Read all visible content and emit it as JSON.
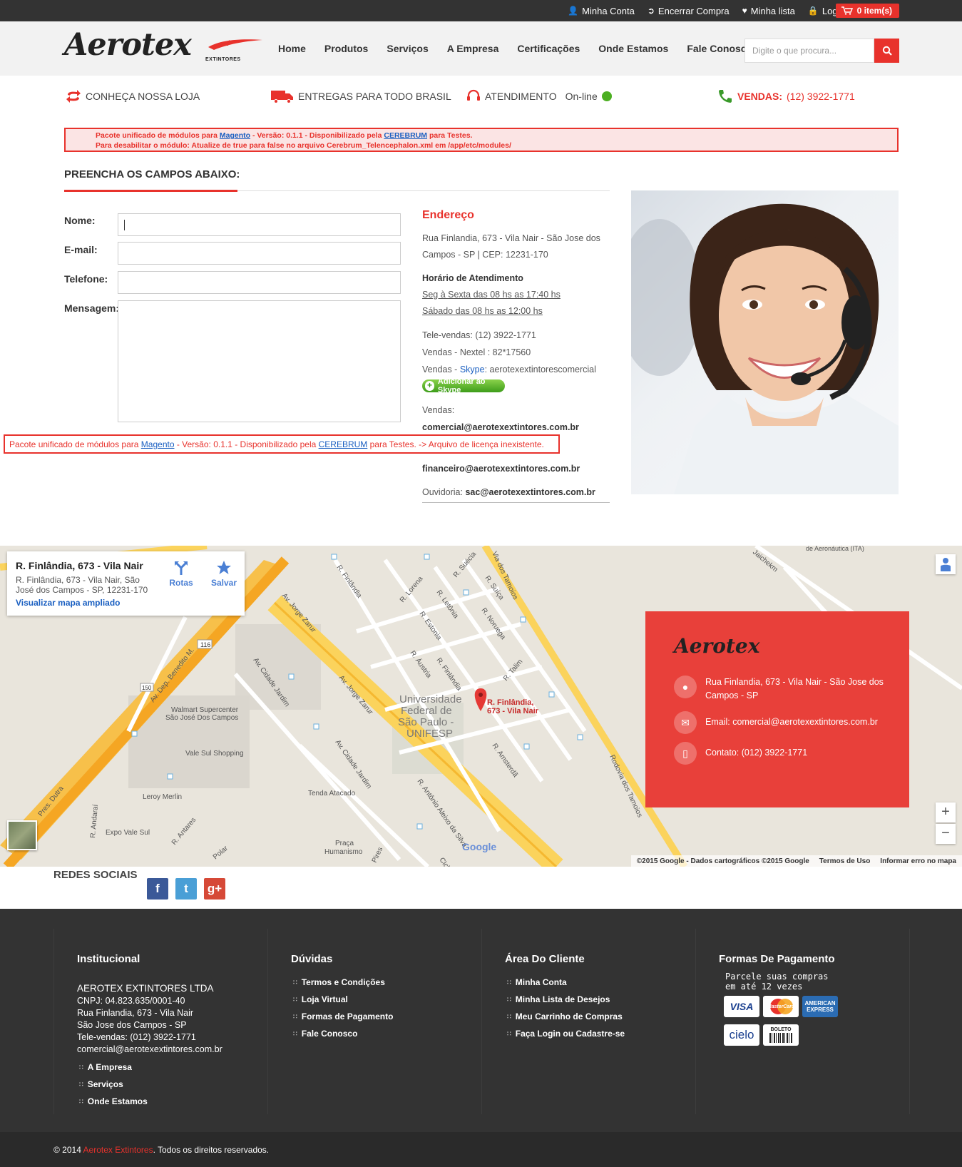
{
  "topbar": {
    "links": [
      {
        "label": "Minha Conta",
        "icon": "user-icon"
      },
      {
        "label": "Encerrar Compra",
        "icon": "checkout-icon"
      },
      {
        "label": "Minha lista",
        "icon": "heart-icon"
      },
      {
        "label": "Log In",
        "icon": "lock-icon"
      }
    ],
    "cart_label": "0 item(s)"
  },
  "header": {
    "logo_text": "Aerotex",
    "logo_sub": "EXTINTORES",
    "nav": [
      "Home",
      "Produtos",
      "Serviços",
      "A Empresa",
      "Certificações",
      "Onde Estamos",
      "Fale Conosco"
    ],
    "search_placeholder": "Digite o que procura..."
  },
  "info_strip": {
    "store": "CONHEÇA NOSSA LOJA",
    "delivery": "ENTREGAS PARA TODO BRASIL",
    "support": "ATENDIMENTO",
    "online": "On-line",
    "sales_label": "VENDAS:",
    "sales_phone": "(12) 3922-1771"
  },
  "notice": {
    "l1_a": "Pacote unificado de módulos para ",
    "l1_link1": "Magento",
    "l1_b": " - Versão: 0.1.1 - Disponibilizado pela ",
    "l1_link2": "CEREBRUM",
    "l1_c": " para Testes.",
    "l2": "Para desabilitar o módulo: Atualize de true para false no arquivo Cerebrum_Telencephalon.xml em /app/etc/modules/"
  },
  "notice2": {
    "a": "Pacote unificado de módulos para ",
    "link1": "Magento",
    "b": " - Versão: 0.1.1 - Disponibilizado pela ",
    "link2": "CEREBRUM",
    "c": " para Testes. -> Arquivo de licença inexistente."
  },
  "form": {
    "title": "PREENCHA OS CAMPOS ABAIXO:",
    "labels": {
      "name": "Nome:",
      "email": "E-mail:",
      "phone": "Telefone:",
      "message": "Mensagem:"
    }
  },
  "address": {
    "title": "Endereço",
    "line1": "Rua Finlandia, 673 - Vila Nair - São Jose dos",
    "line2": "Campos - SP | CEP: 12231-170",
    "hours_title": "Horário de Atendimento",
    "hours1": "Seg à Sexta das 08 hs as 17:40 hs",
    "hours2": "Sábado das 08 hs as 12:00 hs",
    "televendas": "Tele-vendas: (12) 3922-1771",
    "nextel": "Vendas - Nextel : 82*17560",
    "skype_pre": "Vendas - ",
    "skype_word": "Skype",
    "skype_post": ": aerotexextintorescomercial",
    "skype_button": "Adicionar ao Skype",
    "vendas_label": "Vendas:",
    "vendas_email": "comercial@aerotexextintores.com.br",
    "financeiro_email": "financeiro@aerotexextintores.com.br",
    "ouvidoria_label": "Ouvidoria:",
    "ouvidoria_email": "sac@aerotexextintores.com.br"
  },
  "map": {
    "card_title": "R. Finlândia, 673 - Vila Nair",
    "card_address": "R. Finlândia, 673 - Vila Nair, São José dos Campos - SP, 12231-170",
    "card_link": "Visualizar mapa ampliado",
    "routes": "Rotas",
    "save": "Salvar",
    "pin_label_1": "R. Finlândia,",
    "pin_label_2": "673 - Vila Nair",
    "labels": {
      "unifesp": "Universidade Federal de São Paulo - UNIFESP",
      "walmart": "Walmart Supercenter São José Dos Campos",
      "valesul": "Vale Sul Shopping",
      "leroy": "Leroy Merlin",
      "tenda": "Tenda Atacado",
      "expo": "Expo Vale Sul",
      "praca": "Praça Humanismo",
      "aeronautica": "de Aeronáutica (ITA)"
    },
    "roads": [
      "R. Finlândia",
      "R. Suécia",
      "Via dos Tamoios",
      "R. Lorena",
      "R. Letônia",
      "R. Suíça",
      "R. Estonia",
      "R. Noruega",
      "R. Áustria",
      "R. Talim",
      "Av. Jorge Zarur",
      "Av. Dep. Benedito M.",
      "Av. Cidade Jardim",
      "R. Amsterdã",
      "R. Antônio Aleixo da Silva",
      "Rodovia dos Tamoios",
      "Pres. Dutra",
      "R. Andaraí",
      "R. Antares",
      "Polar",
      "Ciclo",
      "Pires",
      "116",
      "150"
    ],
    "footer": [
      "©2015 Google - Dados cartográficos ©2015 Google",
      "Termos de Uso",
      "Informar erro no mapa"
    ],
    "google": "Google",
    "box": {
      "logo": "Aerotex",
      "address": "Rua Finlandia, 673 - Vila Nair - São Jose dos Campos - SP",
      "email": "Email: comercial@aerotexextintores.com.br",
      "contact": "Contato: (012) 3922-1771"
    }
  },
  "social": {
    "title": "REDES SOCIAIS",
    "items": [
      {
        "name": "facebook",
        "glyph": "f",
        "color": "#3b5998"
      },
      {
        "name": "twitter",
        "glyph": "t",
        "color": "#4a9fd6"
      },
      {
        "name": "googleplus",
        "glyph": "g+",
        "color": "#d64937"
      }
    ]
  },
  "footer": {
    "col1": {
      "title": "Institucional",
      "company": "AEROTEX EXTINTORES LTDA",
      "cnpj": "CNPJ: 04.823.635/0001-40",
      "addr1": "Rua Finlandia, 673 - Vila Nair",
      "addr2": "São Jose dos Campos - SP",
      "phone": "Tele-vendas: (012) 3922-1771",
      "email": "comercial@aerotexextintores.com.br",
      "links": [
        "A Empresa",
        "Serviços",
        "Onde Estamos"
      ]
    },
    "col2": {
      "title": "Dúvidas",
      "links": [
        "Termos e Condições",
        "Loja Virtual",
        "Formas de Pagamento",
        "Fale Conosco"
      ]
    },
    "col3": {
      "title": "Área Do Cliente",
      "links": [
        "Minha Conta",
        "Minha Lista de Desejos",
        "Meu Carrinho de Compras",
        "Faça Login ou Cadastre-se"
      ]
    },
    "col4": {
      "title": "Formas De Pagamento",
      "text1": "Parcele suas compras",
      "text2": "em até 12 vezes",
      "cards": [
        "VISA",
        "MasterCard",
        "AMERICAN EXPRESS",
        "cielo",
        "BOLETO"
      ]
    }
  },
  "bottom": {
    "pre": "© 2014 ",
    "brand": "Aerotex Extintores",
    "post": ". Todos os direitos reservados."
  },
  "colors": {
    "accent": "#e8322c",
    "dark": "#333333",
    "link": "#1a5fc1"
  }
}
